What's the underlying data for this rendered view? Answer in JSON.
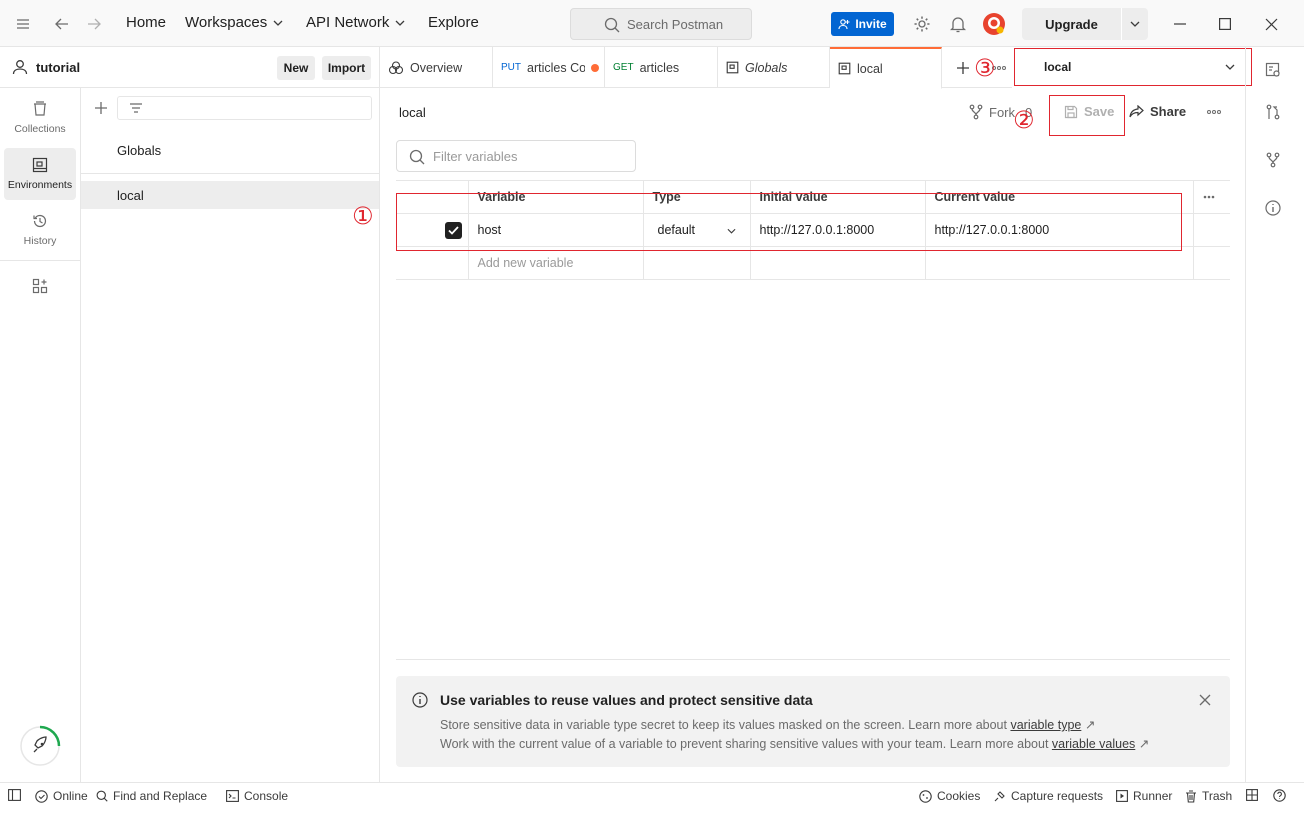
{
  "topbar": {
    "nav": {
      "home": "Home",
      "workspaces": "Workspaces",
      "api_network": "API Network",
      "explore": "Explore"
    },
    "search_placeholder": "Search Postman",
    "invite_label": "Invite",
    "upgrade_label": "Upgrade"
  },
  "workspace": {
    "name": "tutorial",
    "new_label": "New",
    "import_label": "Import"
  },
  "rail": {
    "items": [
      {
        "label": "Collections"
      },
      {
        "label": "Environments"
      },
      {
        "label": "History"
      }
    ]
  },
  "env_list": {
    "items": [
      "Globals",
      "local"
    ]
  },
  "tabs": [
    {
      "label": "Overview"
    },
    {
      "method": "PUT",
      "label": "articles Cop"
    },
    {
      "method": "GET",
      "label": "articles"
    },
    {
      "label": "Globals"
    },
    {
      "label": "local"
    }
  ],
  "env_selector": {
    "value": "local"
  },
  "main": {
    "env_title": "local",
    "fork_label": "Fork",
    "fork_count": "0",
    "save_label": "Save",
    "share_label": "Share",
    "filter_placeholder": "Filter variables",
    "table": {
      "headers": [
        "Variable",
        "Type",
        "Initial value",
        "Current value"
      ],
      "rows": [
        {
          "variable": "host",
          "type": "default",
          "initial": "http://127.0.0.1:8000",
          "current": "http://127.0.0.1:8000"
        }
      ],
      "add_placeholder": "Add new variable"
    },
    "info": {
      "title": "Use variables to reuse values and protect sensitive data",
      "line1_text": "Store sensitive data in variable type secret to keep its values masked on the screen. Learn more about",
      "line1_link": "variable type",
      "line2_text": "Work with the current value of a variable to prevent sharing sensitive values with your team. Learn more about",
      "line2_link": "variable values"
    }
  },
  "annotations": {
    "m1": "①",
    "m2": "②",
    "m3": "③"
  },
  "statusbar": {
    "online": "Online",
    "find_replace": "Find and Replace",
    "console": "Console",
    "cookies": "Cookies",
    "capture": "Capture requests",
    "runner": "Runner",
    "trash": "Trash"
  },
  "colors": {
    "accent": "#ff6c37",
    "invite_blue": "#0265d2",
    "annotation_red": "#e0262f",
    "unsaved_dot": "#ff6c37"
  }
}
